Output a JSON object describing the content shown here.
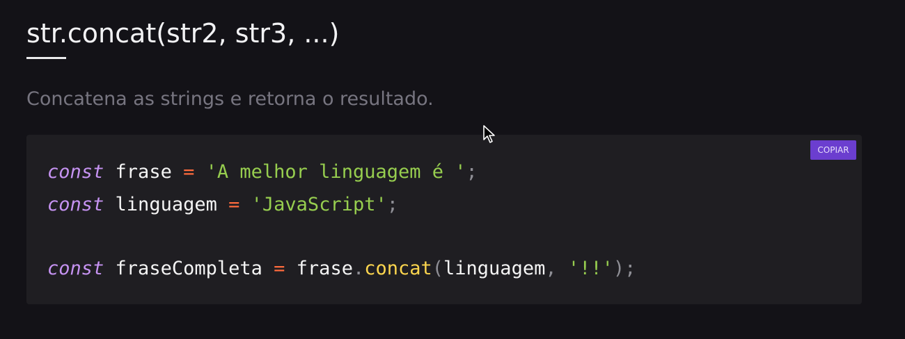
{
  "header": {
    "title": "str.concat(str2, str3, ...)",
    "description": "Concatena as strings e retorna o resultado."
  },
  "code": {
    "copy_label": "COPIAR",
    "line1": {
      "keyword": "const",
      "name": "frase",
      "operator": "=",
      "value": "'A melhor linguagem é '",
      "end": ";"
    },
    "line2": {
      "keyword": "const",
      "name": "linguagem",
      "operator": "=",
      "value": "'JavaScript'",
      "end": ";"
    },
    "line3": {
      "keyword": "const",
      "name": "fraseCompleta",
      "operator": "=",
      "object": "frase",
      "dot": ".",
      "method": "concat",
      "paren_open": "(",
      "arg1": "linguagem",
      "comma": ",",
      "arg2": "'!!'",
      "paren_close": ")",
      "end": ";"
    }
  },
  "colors": {
    "background": "#131217",
    "code_background": "#1f1e22",
    "keyword": "#c693f2",
    "string": "#97ce4f",
    "operator": "#ff6b3d",
    "method": "#fbd54e",
    "copy_button": "#6b3ecf"
  },
  "icons": {
    "cursor": "mouse-pointer-icon"
  }
}
